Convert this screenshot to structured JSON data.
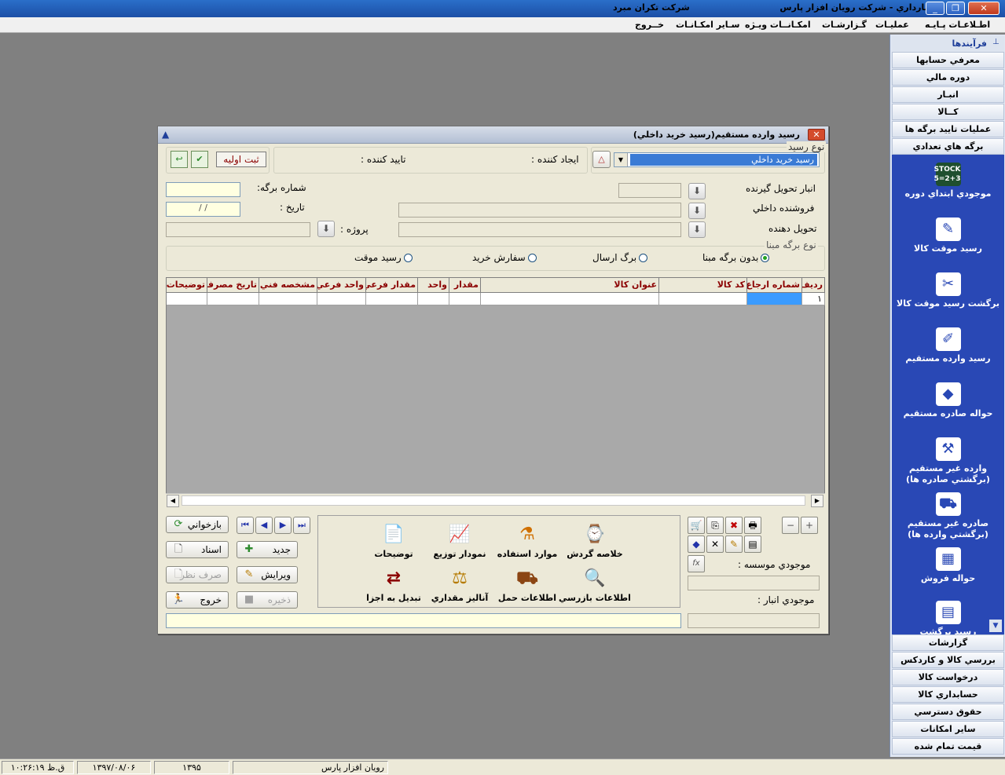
{
  "window": {
    "title": "انبارداري - شركت رويان افزار پارس",
    "company": "شركت تكران مبرد"
  },
  "menu": [
    "اطـلاعـات پـايـه",
    "عمليـات",
    "گـزارشـات",
    "امكـانــات ويـژه",
    "سـاير امكـانـات",
    "خــروج"
  ],
  "sidebar": {
    "header": "فرآيندها",
    "top_items": [
      "معرفي حسابها",
      "دوره مالي",
      "انبـار",
      "كــالا",
      "عمليات تاييد برگه ها",
      "برگه هاي تعدادي"
    ],
    "panel_items": [
      {
        "label": "موجودي ابتداي دوره",
        "icon": "stock-icon"
      },
      {
        "label": "رسيد موقت كالا",
        "icon": "temp-receipt-icon"
      },
      {
        "label": "برگشت رسيد موقت كالا",
        "icon": "return-temp-receipt-icon"
      },
      {
        "label": "رسيد وارده مستقيم",
        "icon": "direct-receipt-icon"
      },
      {
        "label": "حواله صادره مستقيم",
        "icon": "direct-issue-icon"
      },
      {
        "label": "وارده غير مستقيم (برگشتي صادره ها)",
        "icon": "indirect-in-icon"
      },
      {
        "label": "صادره غير مستقيم (برگشتي وارده ها)",
        "icon": "indirect-out-icon"
      },
      {
        "label": "حواله فروش",
        "icon": "sale-icon"
      },
      {
        "label": "رسيد برگشت",
        "icon": "return-receipt-icon"
      }
    ],
    "bottom_items": [
      "گزارشات",
      "بررسي كالا و كاردكس",
      "درخواست كالا",
      "حسابداري كالا",
      "حقوق دسترسي",
      "ساير امكانات",
      "قيمت تمام شده"
    ]
  },
  "dialog": {
    "title": "رسيد وارده مستقيم(رسيد خريد داخلي)",
    "receipt_type_label": "نوع رسيد",
    "receipt_type_value": "رسيد خريد داخلي",
    "creator_label": "ايجاد كننده :",
    "approver_label": "تاييد كننده :",
    "status_badge": "ثبت اوليه",
    "sheet_number_label": "شماره برگه:",
    "date_label": "تاريخ :",
    "date_value": "/ /",
    "project_label": "پروژه :",
    "warehouse_label": "انبار تحويل گيرنده",
    "supplier_label": "فروشنده داخلي",
    "deliverer_label": "تحويل دهنده",
    "base_type_label": "نوع برگه مبنا",
    "base_options": [
      {
        "label": "بدون برگه مبنا",
        "selected": true
      },
      {
        "label": "برگ ارسال",
        "selected": false
      },
      {
        "label": "سفارش خريد",
        "selected": false
      },
      {
        "label": "رسيد موقت",
        "selected": false
      }
    ],
    "grid": {
      "columns": [
        "رديف",
        "شماره ارجاع",
        "كد كالا",
        "عنوان كالا",
        "مقدار",
        "واحد",
        "مقدار فرعي",
        "واحد فرعي",
        "مشخصه فني",
        "تاريخ مصرف",
        "توضيحات"
      ],
      "rows": [
        [
          "١",
          "",
          "",
          "",
          "",
          "",
          "",
          "",
          "",
          "",
          ""
        ]
      ]
    },
    "buttons": {
      "reload": "بازخواني",
      "docs": "اسناد",
      "new": "جديد",
      "cancel": "صرف نظر",
      "edit": "ويرايش",
      "exit": "خروج",
      "save": "ذخيره"
    },
    "tools": [
      {
        "label": "خلاصه گردش",
        "icon": "summary-icon"
      },
      {
        "label": "موارد استفاده",
        "icon": "usage-icon"
      },
      {
        "label": "نمودار توزيع",
        "icon": "chart-icon"
      },
      {
        "label": "توضيحات",
        "icon": "notes-icon"
      },
      {
        "label": "اطلاعات بازرسي",
        "icon": "inspection-icon"
      },
      {
        "label": "اطلاعات حمل",
        "icon": "shipping-icon"
      },
      {
        "label": "آناليز مقداري",
        "icon": "analysis-icon"
      },
      {
        "label": "تبديل به اجزا",
        "icon": "convert-icon"
      }
    ],
    "company_stock_label": "موجودي موسسه :",
    "warehouse_stock_label": "موجودي انبار :",
    "fx_label": "fx"
  },
  "status": {
    "company": "رويان افزار پارس",
    "year": "١٣٩۵",
    "date": "١٣٩٧/٠٨/٠۶",
    "time": "ق.ظ ١٠:٢۶:١٩"
  }
}
